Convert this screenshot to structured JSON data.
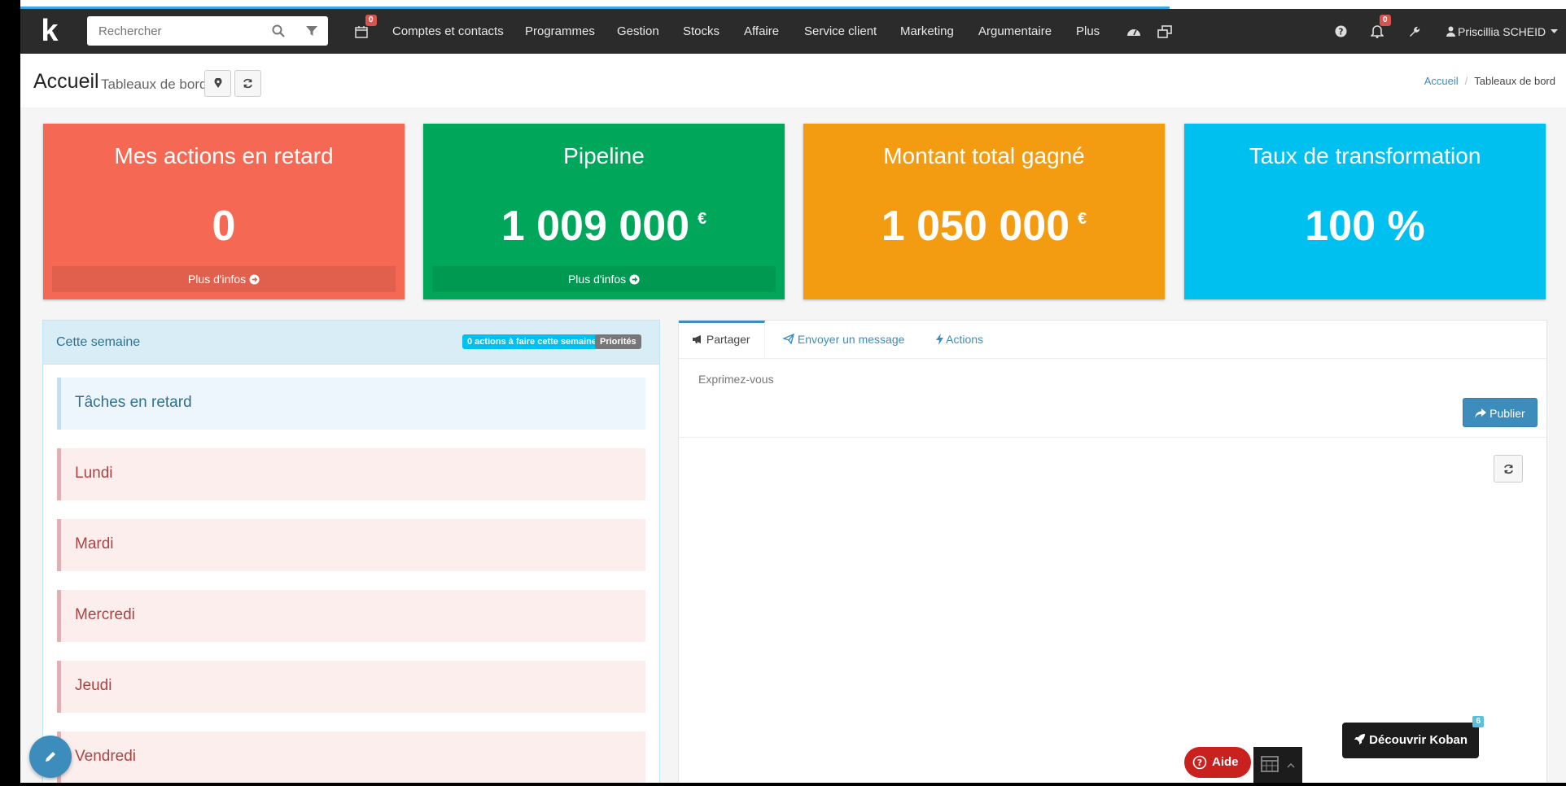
{
  "navbar": {
    "search_placeholder": "Rechercher",
    "calendar_badge": "0",
    "menu": [
      "Comptes et contacts",
      "Programmes",
      "Gestion",
      "Stocks",
      "Affaire",
      "Service client",
      "Marketing",
      "Argumentaire",
      "Plus"
    ],
    "notifications_badge": "0",
    "user": "Priscillia SCHEID"
  },
  "header": {
    "title": "Accueil",
    "subtitle": "Tableaux de bord",
    "breadcrumb": [
      "Accueil",
      "Tableaux de bord"
    ]
  },
  "kpis": [
    {
      "title": "Mes actions en retard",
      "value": "0",
      "unit": "",
      "more": "Plus d'infos",
      "color": "#f56954"
    },
    {
      "title": "Pipeline",
      "value": "1 009 000",
      "unit": "€",
      "more": "Plus d'infos",
      "color": "#00a65a"
    },
    {
      "title": "Montant total gagné",
      "value": "1 050 000",
      "unit": "€",
      "more": "",
      "color": "#f39c12"
    },
    {
      "title": "Taux de transformation",
      "value": "100 %",
      "unit": "",
      "more": "",
      "color": "#00c0ef"
    }
  ],
  "week": {
    "title": "Cette semaine",
    "badge_actions": "0 actions à faire cette semaine",
    "badge_priorities": "Priorités",
    "late": "Tâches en retard",
    "days": [
      "Lundi",
      "Mardi",
      "Mercredi",
      "Jeudi",
      "Vendredi"
    ]
  },
  "social": {
    "tabs": [
      "Partager",
      "Envoyer un message",
      "Actions"
    ],
    "placeholder": "Exprimez-vous",
    "publish": "Publier"
  },
  "floating": {
    "help": "Aide",
    "discover": "Découvrir Koban",
    "discover_count": "6"
  },
  "icons": [
    "search-icon",
    "filter-icon",
    "calendar-icon",
    "dashboard-icon",
    "windows-icon",
    "question-icon",
    "bell-icon",
    "wrench-icon",
    "user-icon",
    "map-marker-icon",
    "refresh-icon",
    "arrow-circle-right-icon",
    "bullhorn-icon",
    "paper-plane-icon",
    "bolt-icon",
    "share-icon",
    "pencil-icon",
    "rocket-icon"
  ]
}
